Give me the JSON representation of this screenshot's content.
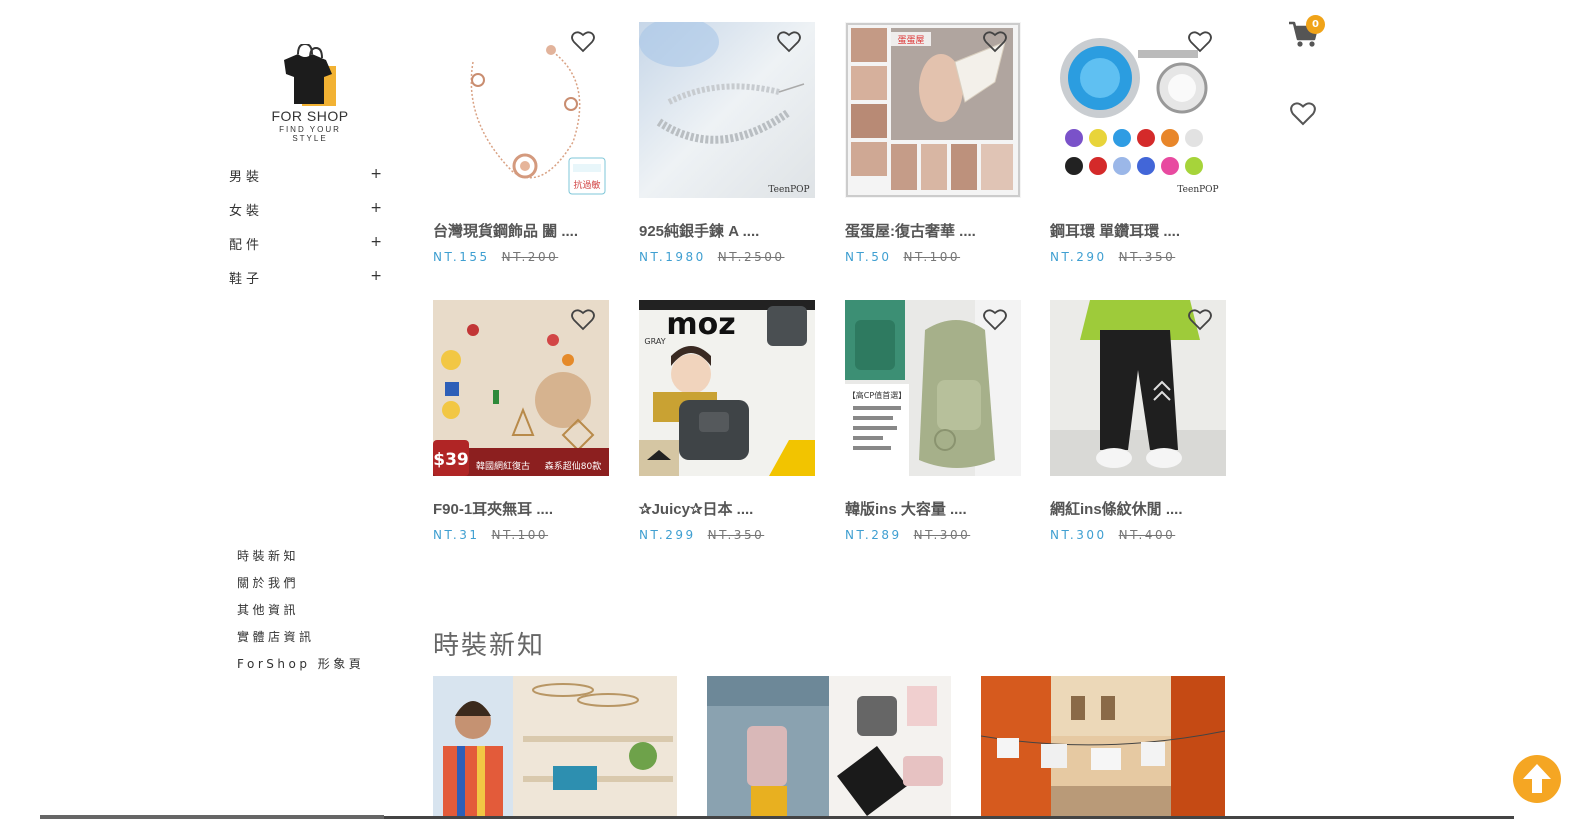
{
  "brand": {
    "title": "FOR SHOP",
    "subtitle": "FIND YOUR STYLE"
  },
  "categories": [
    {
      "label": "男裝",
      "toggle": "+"
    },
    {
      "label": "女裝",
      "toggle": "+"
    },
    {
      "label": "配件",
      "toggle": "+"
    },
    {
      "label": "鞋子",
      "toggle": "+"
    }
  ],
  "info_links": [
    "時裝新知",
    "關於我們",
    "其他資訊",
    "實體店資訊",
    "ForShop 形象頁"
  ],
  "products": [
    {
      "name": "台灣現貨鋼飾品 闔 ....",
      "price": "NT.155",
      "original": "NT.200"
    },
    {
      "name": "925純銀手鍊 A ....",
      "price": "NT.1980",
      "original": "NT.2500"
    },
    {
      "name": "蛋蛋屋:復古奢華 ....",
      "price": "NT.50",
      "original": "NT.100"
    },
    {
      "name": "鋼耳環 單鑽耳環 ....",
      "price": "NT.290",
      "original": "NT.350"
    },
    {
      "name": "F90-1耳夾無耳 ....",
      "price": "NT.31",
      "original": "NT.100"
    },
    {
      "name": "✰Juicy✰日本 ....",
      "price": "NT.299",
      "original": "NT.350"
    },
    {
      "name": "韓版ins 大容量 ....",
      "price": "NT.289",
      "original": "NT.300"
    },
    {
      "name": "網紅ins條紋休閒 ....",
      "price": "NT.300",
      "original": "NT.400"
    }
  ],
  "image_text": {
    "anti_allergy": "抗過敏",
    "teenpop": "TeenPOP",
    "eggshop": "蛋蛋屋",
    "price_tag": "$39",
    "earring_banner": "韓國網紅復古",
    "earring_banner2": "森系超仙80款",
    "magazine": "moz",
    "gray_label": "GRAY",
    "bag_banner": "【高CP值首選】"
  },
  "news": {
    "title": "時裝新知"
  },
  "cart": {
    "count": "0"
  },
  "colors": {
    "price": "#3f9fd1",
    "badge": "#f0a318",
    "top_button": "#f5a623"
  },
  "icons": [
    "cart-icon",
    "heart-icon",
    "arrow-up-icon",
    "tshirt-bag-logo"
  ]
}
